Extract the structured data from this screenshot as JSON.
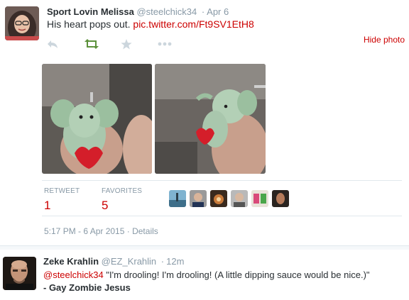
{
  "tweet": {
    "fullname": "Sport Lovin Melissa",
    "username": "@steelchick34",
    "separator": "·",
    "time": "Apr 6",
    "text": "His heart pops out.",
    "link": "pic.twitter.com/Ft9SV1EtH8",
    "hide_photo": "Hide photo",
    "actions": {
      "reply_icon": "reply-icon",
      "retweet_icon": "retweet-icon",
      "favorite_icon": "star-icon",
      "more_icon": "more-icon",
      "retweet_active_color": "#5c913b",
      "inactive_color": "#ccd6dd"
    },
    "stats": {
      "retweet_label": "RETWEET",
      "retweet_count": "1",
      "favorites_label": "FAVORITES",
      "favorites_count": "5"
    },
    "timestamp": "5:17 PM - 6 Apr 2015",
    "meta_separator": "·",
    "details": "Details"
  },
  "reply": {
    "fullname": "Zeke Krahlin",
    "username": "@EZ_Krahlin",
    "separator": "·",
    "time": "12m",
    "mention": "@steelchick34",
    "text": " \"I'm drooling! I'm drooling! (A little dipping sauce would be nice.)\"",
    "signature": "- Gay Zombie Jesus"
  },
  "colors": {
    "accent": "#cc0000",
    "muted": "#8899a6",
    "text": "#292f33"
  }
}
